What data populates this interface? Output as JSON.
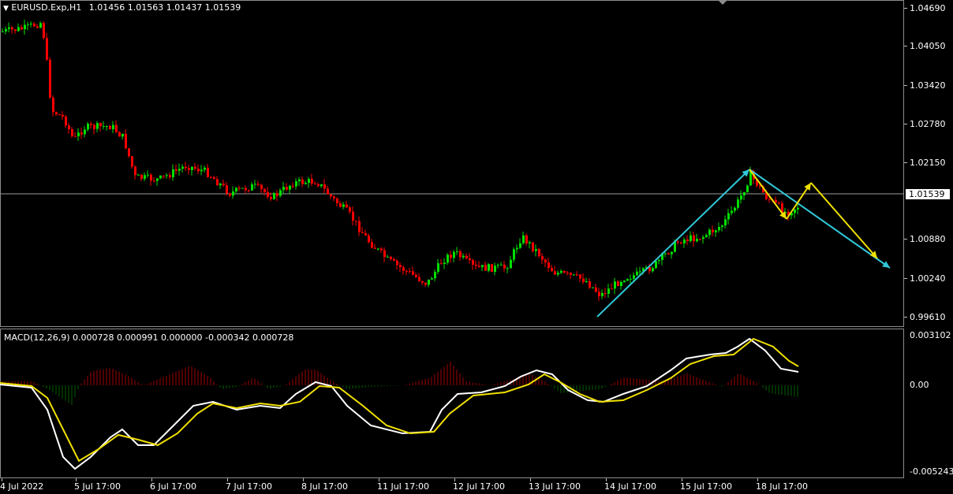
{
  "header": {
    "symbol_label": "EURUSD.Exp,H1",
    "ohlc": "1.01456 1.01563 1.01437 1.01539",
    "dropdown_icon": "triangle-down-icon"
  },
  "price_axis": {
    "labels": [
      "1.04690",
      "1.04050",
      "1.03420",
      "1.02780",
      "1.02150",
      "1.00880",
      "1.00240",
      "0.99610"
    ],
    "current_price": "1.01539"
  },
  "macd": {
    "label": "MACD(12,26,9) 0.000728 0.000991 0.000000 -0.000342 0.000728",
    "axis_labels": [
      "0.003102",
      "0.00",
      "-0.005243"
    ]
  },
  "time_axis": {
    "labels": [
      "4 Jul 2022",
      "5 Jul 17:00",
      "6 Jul 17:00",
      "7 Jul 17:00",
      "8 Jul 17:00",
      "11 Jul 17:00",
      "12 Jul 17:00",
      "13 Jul 17:00",
      "14 Jul 17:00",
      "15 Jul 17:00",
      "18 Jul 17:00"
    ]
  },
  "colors": {
    "bull": "#00e000",
    "bear": "#ff0000",
    "hist_up": "#a00000",
    "hist_down": "#006000",
    "macd_line": "#ffffff",
    "signal_line": "#f0e000",
    "arrow_cyan": "#30c8d8",
    "arrow_yellow": "#f0e000"
  }
}
